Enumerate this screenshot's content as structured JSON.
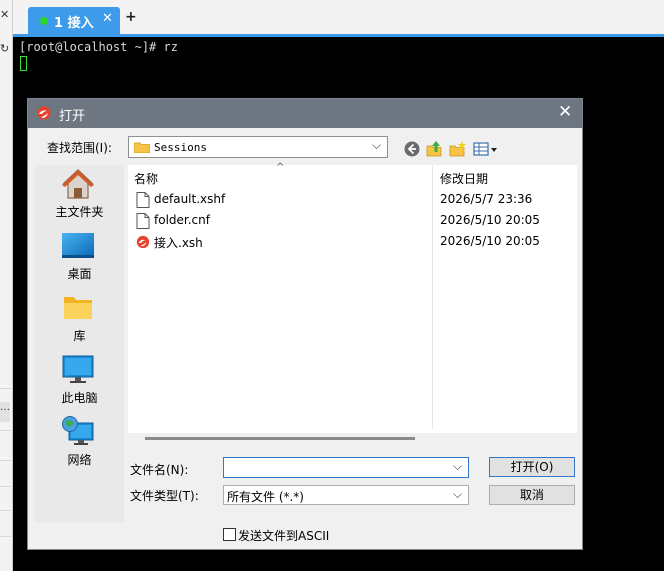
{
  "tabs": [
    {
      "label": "1 接入",
      "close": "✕"
    }
  ],
  "new_tab": "+",
  "terminal": {
    "prompt_line": "[root@localhost ~]# rz"
  },
  "dialog": {
    "title": "打开",
    "close": "✕",
    "look_in_label": "查找范围(I):",
    "look_in_value": "Sessions",
    "places": [
      {
        "label": "主文件夹",
        "icon": "home-icon"
      },
      {
        "label": "桌面",
        "icon": "desktop-icon"
      },
      {
        "label": "库",
        "icon": "library-folder-icon"
      },
      {
        "label": "此电脑",
        "icon": "computer-icon"
      },
      {
        "label": "网络",
        "icon": "network-icon"
      }
    ],
    "columns": {
      "name": "名称",
      "modified": "修改日期"
    },
    "files": [
      {
        "name": "default.xshf",
        "modified": "2026/5/7 23:36",
        "icon": "document-icon"
      },
      {
        "name": "folder.cnf",
        "modified": "2026/5/10 20:05",
        "icon": "document-icon"
      },
      {
        "name": "接入.xsh",
        "modified": "2026/5/10 20:05",
        "icon": "xshell-session-icon"
      }
    ],
    "filename_label": "文件名(N):",
    "filename_value": "",
    "filetype_label": "文件类型(T):",
    "filetype_value": "所有文件 (*.*)",
    "open_button": "打开(O)",
    "cancel_button": "取消",
    "ascii_checkbox": {
      "label": "发送文件到ASCII",
      "checked": false
    }
  },
  "colors": {
    "tab_accent": "#3d9be9",
    "dialog_titlebar": "#6e7781",
    "terminal_bg": "#000000",
    "cursor": "#35e035"
  }
}
